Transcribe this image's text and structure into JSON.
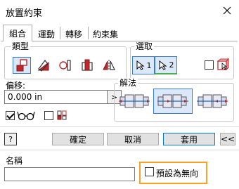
{
  "window": {
    "title": "放置約束",
    "close_icon": "close-icon"
  },
  "tabs": [
    {
      "label": "組合",
      "active": true
    },
    {
      "label": "運動",
      "active": false
    },
    {
      "label": "轉移",
      "active": false
    },
    {
      "label": "約束集",
      "active": false
    }
  ],
  "type_group": {
    "label": "類型",
    "buttons": [
      {
        "icon": "mate-constraint-icon",
        "selected": true
      },
      {
        "icon": "angle-constraint-icon",
        "selected": false
      },
      {
        "icon": "tangent-constraint-icon",
        "selected": false
      },
      {
        "icon": "insert-constraint-icon",
        "selected": false
      },
      {
        "icon": "symmetry-constraint-icon",
        "selected": false
      }
    ]
  },
  "selection_group": {
    "label": "選取",
    "buttons": [
      {
        "label": "1",
        "icon": "select-arrow-icon"
      },
      {
        "label": "2",
        "icon": "select-arrow-icon"
      }
    ],
    "first_click_checkbox_checked": false,
    "first_click_icon": "pick-part-first-icon"
  },
  "offset": {
    "label": "偏移:",
    "value": "0.000 in",
    "arrow": ">"
  },
  "preview": {
    "show_preview_checked": true,
    "preview_icon": "glasses-icon",
    "predict_checked": false,
    "predict_icon": "predict-offset-icon"
  },
  "solution_group": {
    "label": "解法",
    "buttons": [
      {
        "icon": "solution-mate-icon",
        "selected": false
      },
      {
        "icon": "solution-flush-icon",
        "selected": true
      },
      {
        "icon": "solution-opposed-icon",
        "selected": false
      }
    ]
  },
  "actions": {
    "help": "?",
    "ok": "確定",
    "cancel": "取消",
    "apply": "套用",
    "collapse": "<<"
  },
  "name_section": {
    "label": "名稱",
    "value": "",
    "default_checkbox_checked": false,
    "default_label": "預設為無向"
  }
}
